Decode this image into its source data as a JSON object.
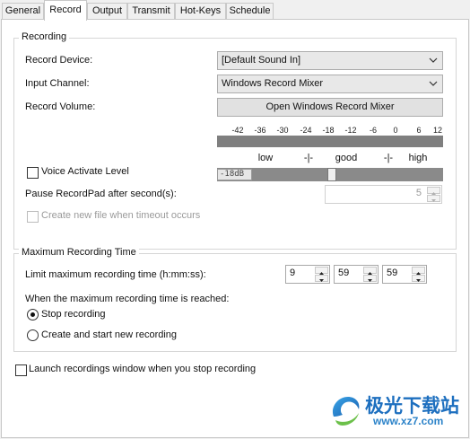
{
  "tabs": [
    {
      "label": "General"
    },
    {
      "label": "Record"
    },
    {
      "label": "Output"
    },
    {
      "label": "Transmit"
    },
    {
      "label": "Hot-Keys"
    },
    {
      "label": "Schedule"
    }
  ],
  "active_tab": "Record",
  "recording_group": {
    "title": "Recording",
    "record_device_label": "Record Device:",
    "record_device_value": "[Default Sound In]",
    "input_channel_label": "Input Channel:",
    "input_channel_value": "Windows Record Mixer",
    "record_volume_label": "Record Volume:",
    "open_mixer_button": "Open Windows Record Mixer",
    "meter_scale": [
      "-42",
      "-36",
      "-30",
      "-24",
      "-18",
      "-12",
      "-6",
      "0",
      "6",
      "12"
    ],
    "meter_zones": [
      "low",
      "-|-",
      "good",
      "-|-",
      "high"
    ],
    "voice_activate_label": "Voice Activate Level",
    "voice_activate_checked": false,
    "voice_level_value": "-18dB",
    "pause_label": "Pause RecordPad after second(s):",
    "pause_value": "5",
    "create_new_file_label": "Create new file when timeout occurs",
    "create_new_file_checked": false
  },
  "max_time_group": {
    "title": "Maximum Recording Time",
    "limit_label": "Limit maximum recording time (h:mm:ss):",
    "hours": "9",
    "minutes": "59",
    "seconds": "59",
    "when_reached_label": "When the maximum recording time is reached:",
    "option_stop": "Stop recording",
    "option_new": "Create and start new recording",
    "selected_option": "Stop recording"
  },
  "launch_window_label": "Launch recordings window when you stop recording",
  "launch_window_checked": false,
  "watermark": {
    "brand_text": "极光下载站",
    "url_text": "www.xz7.com"
  },
  "colors": {
    "meter_bar": "#7f7f7f",
    "watermark_blue": "#1d6fbf"
  }
}
